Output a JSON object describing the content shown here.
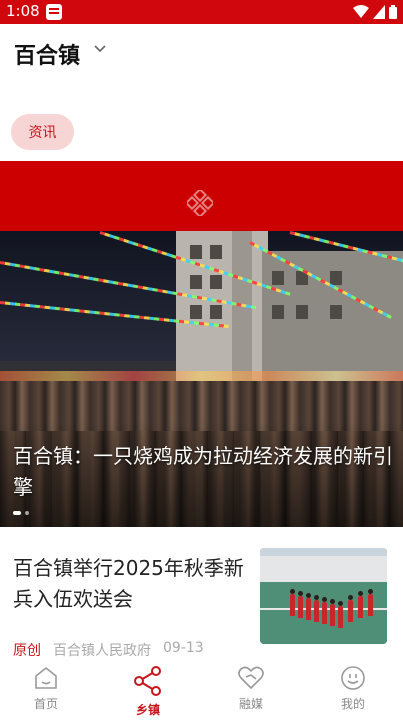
{
  "status_bar": {
    "time": "1:08"
  },
  "header": {
    "town_name": "百合镇"
  },
  "tabs": [
    {
      "label": "资讯",
      "selected": true
    }
  ],
  "hero": {
    "caption": "百合镇：一只烧鸡成为拉动经济发展的新引擎",
    "carousel_total": 2,
    "carousel_active": 1
  },
  "news": [
    {
      "title": "百合镇举行2025年秋季新兵入伍欢送会",
      "tag": "原创",
      "source": "百合镇人民政府",
      "date": "09-13"
    }
  ],
  "bottom_nav": [
    {
      "label": "首页",
      "icon": "home-icon",
      "active": false
    },
    {
      "label": "乡镇",
      "icon": "share-icon",
      "active": true
    },
    {
      "label": "融媒",
      "icon": "heart-icon",
      "active": false
    },
    {
      "label": "我的",
      "icon": "smiley-icon",
      "active": false
    }
  ],
  "colors": {
    "brand_red": "#cc0000",
    "accent_red": "#c7151b",
    "pill_bg": "#f7d5d5"
  }
}
